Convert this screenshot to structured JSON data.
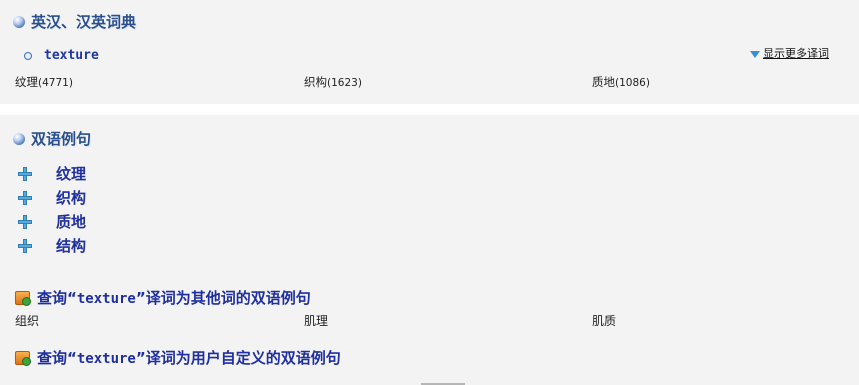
{
  "dict_section": {
    "title": "英汉、汉英词典",
    "headword": "texture",
    "more_link": "显示更多译词",
    "translations": [
      {
        "word": "纹理",
        "count": "(4771)"
      },
      {
        "word": "织构",
        "count": "(1623)"
      },
      {
        "word": "质地",
        "count": "(1086)"
      }
    ]
  },
  "bilingual_section": {
    "title": "双语例句",
    "senses": [
      "纹理",
      "织构",
      "质地",
      "结构"
    ],
    "query_other": {
      "prefix": "查询“",
      "word": "texture",
      "suffix": "”译词为其他词的双语例句"
    },
    "other_words": [
      "组织",
      "肌理",
      "肌质"
    ],
    "query_user": {
      "prefix": "查询“",
      "word": "texture",
      "suffix": "”译词为用户自定义的双语例句"
    }
  },
  "icons": {
    "section": "blue-ball-icon",
    "expand": "plus-icon",
    "more": "down-arrow-icon",
    "query": "rss-feed-icon",
    "headword": "bullet-circle-icon"
  },
  "colors": {
    "panel_bg": "#f3f3f3",
    "title": "#2a4f8c",
    "link": "#1f2fa0",
    "plus": "#5aa9dc"
  }
}
